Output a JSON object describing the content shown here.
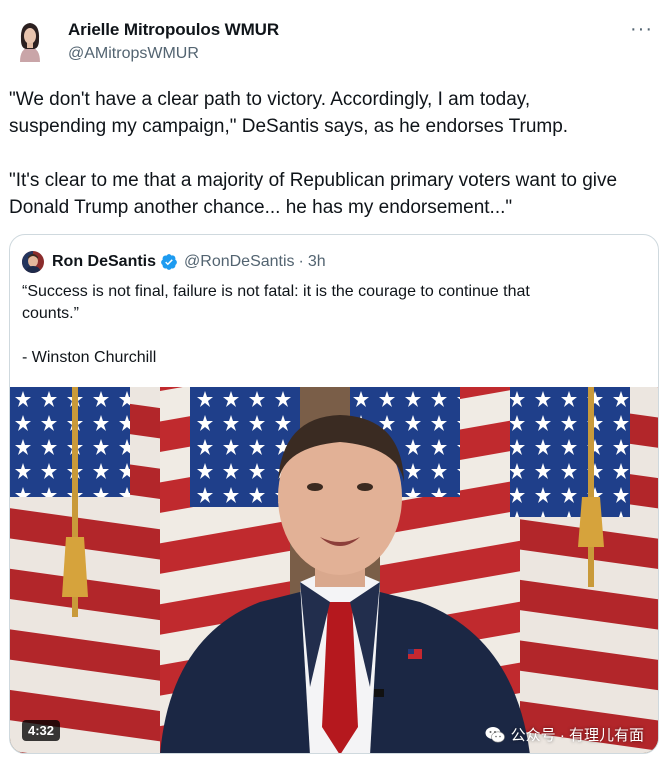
{
  "author": {
    "display_name": "Arielle Mitropoulos WMUR",
    "handle": "@AMitropsWMUR"
  },
  "menu_icon": "more-horizontal-icon",
  "tweet_text": [
    "\"We don't have a clear path to victory. Accordingly, I am today,\nsuspending my campaign,\" DeSantis says, as he endorses Trump.",
    "\"It's clear to me that a majority of Republican primary voters want to give\nDonald Trump another chance... he has my endorsement...\""
  ],
  "quoted_tweet": {
    "display_name": "Ron DeSantis",
    "verified_icon": "verified-badge-icon",
    "handle": "@RonDeSantis",
    "separator": "·",
    "time": "3h",
    "text": [
      "“Success is not final, failure is not fatal: it is the courage to continue that\ncounts.”",
      "- Winston Churchill"
    ],
    "video": {
      "duration": "4:32"
    }
  },
  "watermark": {
    "icon": "wechat-icon",
    "text": "公众号 · 有理儿有面"
  },
  "colors": {
    "text_primary": "#0f1419",
    "text_secondary": "#536471",
    "verified_blue": "#1d9bf0",
    "border": "#cfd9de"
  }
}
